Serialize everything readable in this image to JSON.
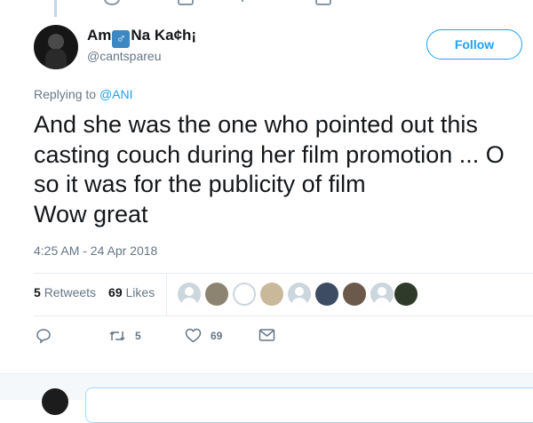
{
  "tweet": {
    "user": {
      "name_part1": "Am",
      "name_symbol": "♂",
      "name_part2": "Na Ka¢h¡",
      "handle": "@cantspareu",
      "avatar_icon": "avatar-photo"
    },
    "follow_label": "Follow",
    "replying_prefix": "Replying to",
    "replying_mention": "@ANI",
    "text_lines": [
      "And she was the one who pointed out this",
      "casting couch during her film promotion ... O",
      "so it was for the publicity of film",
      "Wow great"
    ],
    "timestamp": "4:25 AM - 24 Apr 2018",
    "retweets_count": "5",
    "retweets_label": "Retweets",
    "likes_count": "69",
    "likes_label": "Likes",
    "likers": [
      {
        "icon": "default-avatar"
      },
      {
        "icon": "photo-avatar",
        "color": "#8c8470"
      },
      {
        "icon": "outline-avatar"
      },
      {
        "icon": "photo-avatar",
        "color": "#c9b89a"
      },
      {
        "icon": "default-avatar"
      },
      {
        "icon": "photo-avatar",
        "color": "#3d4c63"
      },
      {
        "icon": "photo-avatar",
        "color": "#6b5a4c"
      },
      {
        "icon": "default-avatar"
      },
      {
        "icon": "photo-avatar",
        "color": "#2f3a2a"
      }
    ],
    "actions": {
      "reply_icon": "reply-icon",
      "retweet_icon": "retweet-icon",
      "retweet_count": "5",
      "like_icon": "heart-icon",
      "like_count": "69",
      "dm_icon": "envelope-icon"
    }
  },
  "colors": {
    "accent": "#1da1f2",
    "secondary_text": "#657786",
    "primary_text": "#14171a",
    "separator": "#e6ecf0"
  }
}
